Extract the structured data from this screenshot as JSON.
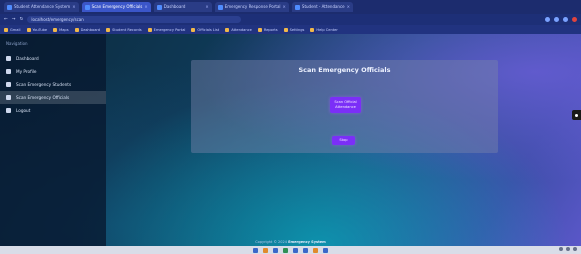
{
  "browser": {
    "tabs": [
      {
        "label": "Student Attendance System",
        "active": false
      },
      {
        "label": "Scan Emergency Officials",
        "active": true
      },
      {
        "label": "Dashboard",
        "active": false
      },
      {
        "label": "Emergency Response Portal",
        "active": false
      },
      {
        "label": "Student - Attendance",
        "active": false
      }
    ],
    "address": "localhost/emergency/scan",
    "bookmarks": [
      "Gmail",
      "YouTube",
      "Maps",
      "Dashboard",
      "Student Records",
      "Emergency Portal",
      "Officials List",
      "Attendance",
      "Reports",
      "Settings",
      "Help Center"
    ]
  },
  "sidebar": {
    "header": "Navigation",
    "items": [
      {
        "label": "Dashboard",
        "icon": "dashboard-icon",
        "active": false
      },
      {
        "label": "My Profile",
        "icon": "user-icon",
        "active": false
      },
      {
        "label": "Scan Emergency Students",
        "icon": "scan-icon",
        "active": false
      },
      {
        "label": "Scan Emergency Officials",
        "icon": "scan-icon",
        "active": true
      },
      {
        "label": "Logout",
        "icon": "logout-icon",
        "active": false
      }
    ]
  },
  "main": {
    "title": "Scan Emergency Officials",
    "scan_button": "Scan Official Attendance",
    "stop_button": "Stop"
  },
  "footer": {
    "text": "Copyright © 2024",
    "brand": "Emergency System"
  },
  "colors": {
    "accent": "#7b2ff7",
    "sidebar_bg": "#081830",
    "browser_chrome": "#1c2c6e"
  }
}
